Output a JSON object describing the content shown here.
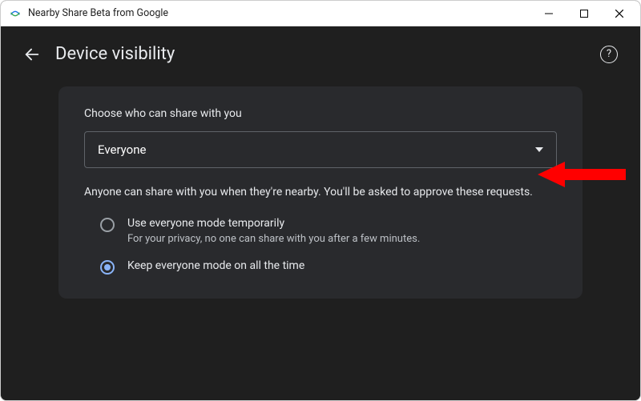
{
  "window": {
    "title": "Nearby Share Beta from Google"
  },
  "page": {
    "title": "Device visibility"
  },
  "section": {
    "label": "Choose who can share with you"
  },
  "dropdown": {
    "value": "Everyone"
  },
  "description": "Anyone can share with you when they're nearby. You'll be asked to approve these requests.",
  "radios": {
    "temporary": {
      "label": "Use everyone mode temporarily",
      "sub": "For your privacy, no one can share with you after a few minutes."
    },
    "always": {
      "label": "Keep everyone mode on all the time"
    }
  }
}
